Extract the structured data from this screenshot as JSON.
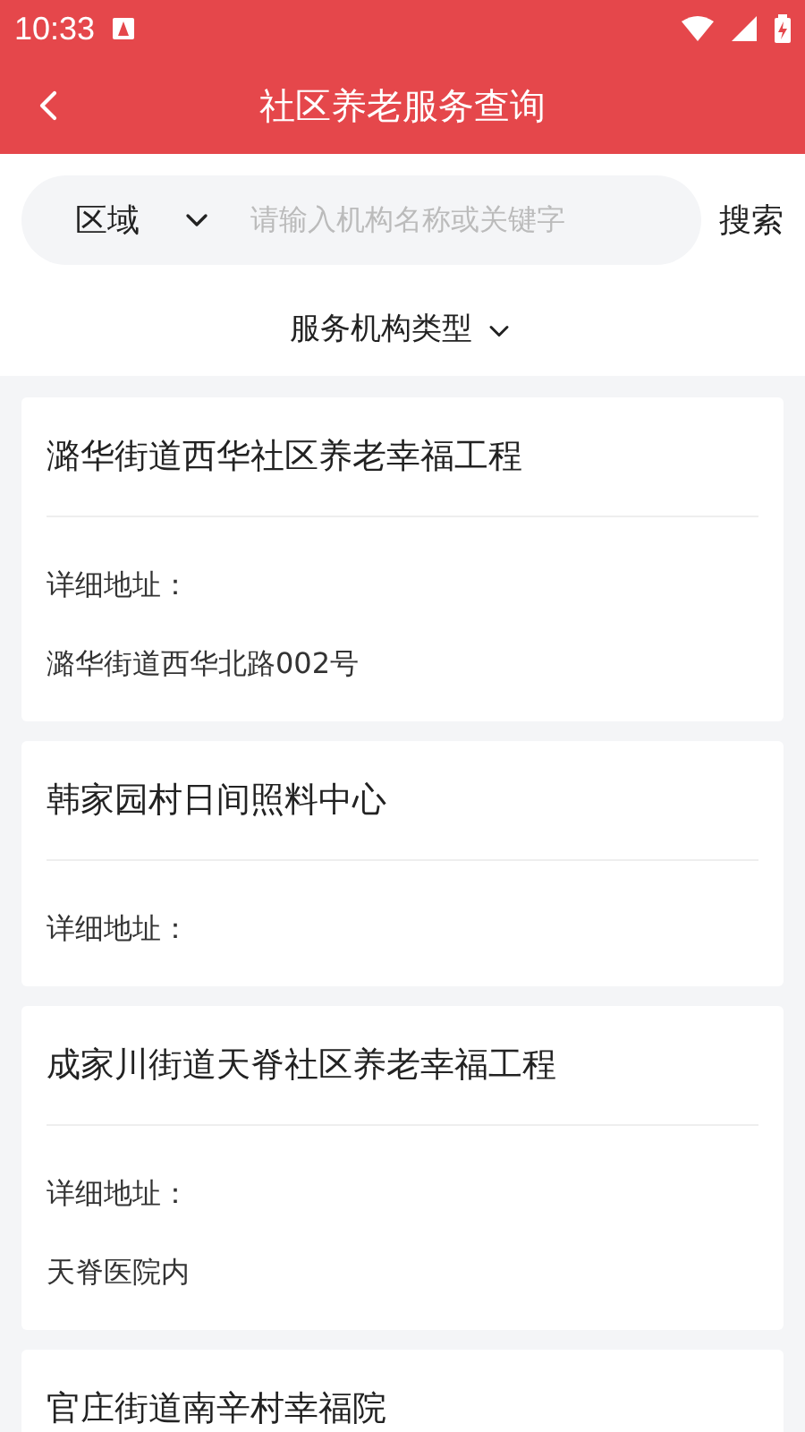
{
  "status_bar": {
    "time": "10:33"
  },
  "header": {
    "title": "社区养老服务查询"
  },
  "search": {
    "region": "区域",
    "placeholder": "请输入机构名称或关键字",
    "button": "搜索"
  },
  "filter": {
    "label": "服务机构类型"
  },
  "institutions": [
    {
      "name": "潞华街道西华社区养老幸福工程",
      "address_label": "详细地址：",
      "address": "潞华街道西华北路002号"
    },
    {
      "name": "韩家园村日间照料中心",
      "address_label": "详细地址："
    },
    {
      "name": "成家川街道天脊社区养老幸福工程",
      "address_label": "详细地址：",
      "address": "天脊医院内"
    },
    {
      "name": "官庄街道南辛村幸福院"
    }
  ]
}
